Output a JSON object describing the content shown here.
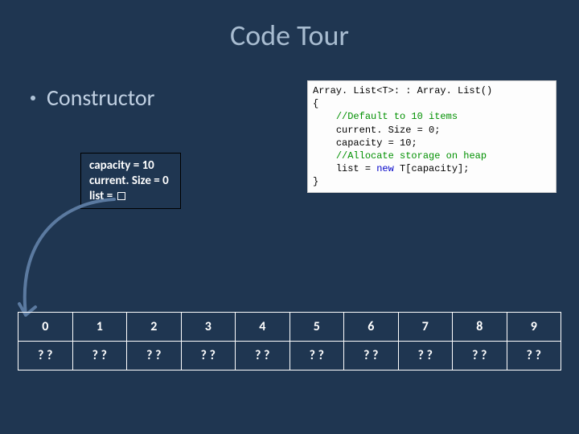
{
  "title": "Code Tour",
  "bullet": "Constructor",
  "state": {
    "line1": "capacity = 10",
    "line2": "current. Size = 0",
    "line3_prefix": "list = "
  },
  "code": {
    "sig_pre": "Array. List<T>: : Array. List",
    "sig_post": "()",
    "brace_open": "{",
    "c1": "//Default to 10 items",
    "l1a": "current. Size = ",
    "l1b": "0",
    "l1c": ";",
    "l2a": "capacity = ",
    "l2b": "10",
    "l2c": ";",
    "c2": "//Allocate storage on heap",
    "l3a": "list = ",
    "l3kw": "new",
    "l3b": " T[capacity];",
    "brace_close": "}"
  },
  "array": {
    "indices": [
      "0",
      "1",
      "2",
      "3",
      "4",
      "5",
      "6",
      "7",
      "8",
      "9"
    ],
    "values": [
      "? ?",
      "? ?",
      "? ?",
      "? ?",
      "? ?",
      "? ?",
      "? ?",
      "? ?",
      "? ?",
      "? ?"
    ]
  }
}
